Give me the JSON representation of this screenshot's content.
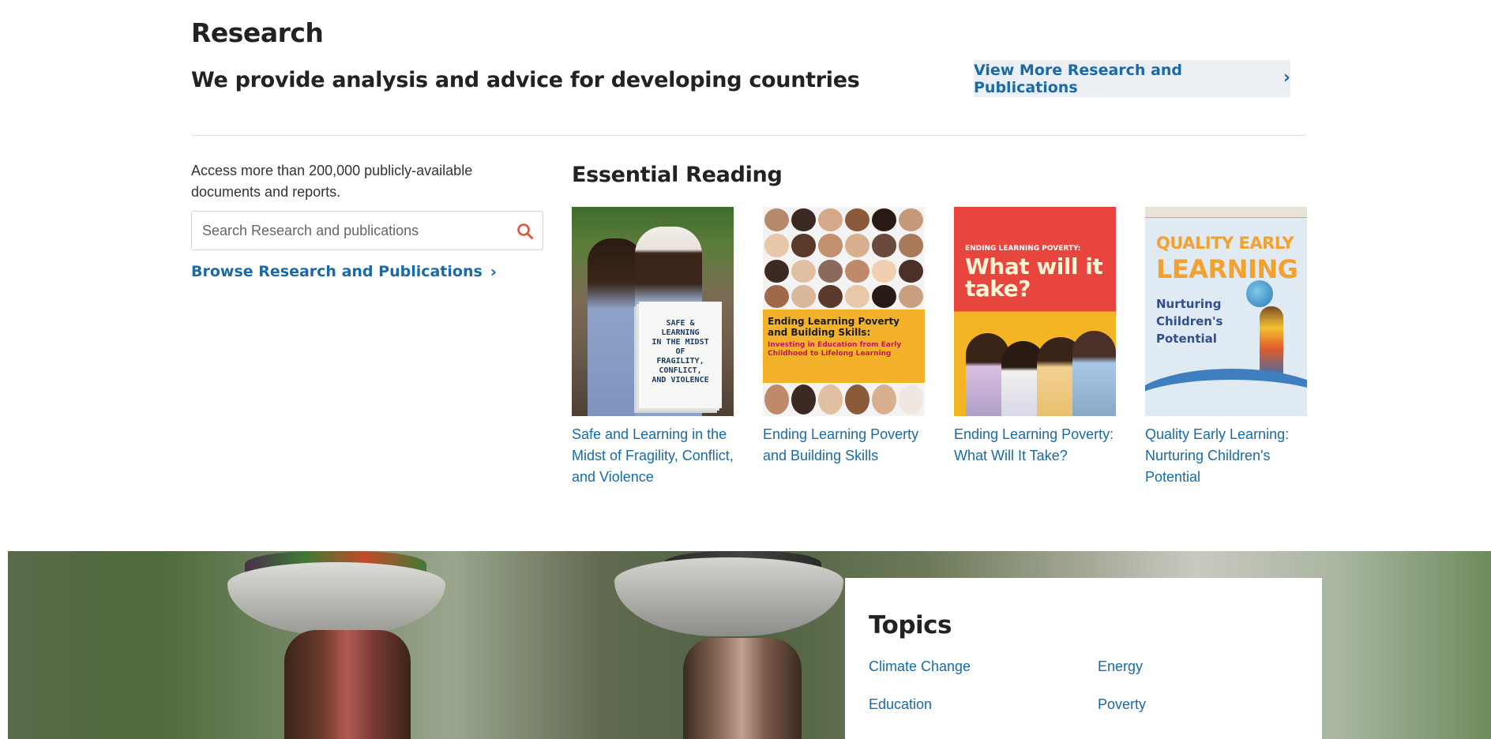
{
  "header": {
    "title": "Research",
    "subtitle": "We provide analysis and advice for developing countries",
    "view_more_label": "View More Research and Publications",
    "view_more_chevron": "›"
  },
  "search_panel": {
    "description": "Access more than 200,000 publicly-available documents and reports.",
    "search_placeholder": "Search Research and publications",
    "browse_label": "Browse Research and Publications",
    "browse_chevron": "›"
  },
  "essential_reading": {
    "title": "Essential Reading",
    "books": [
      {
        "title": "Safe and Learning in the Midst of Fragility, Conflict, and Violence",
        "cover_lines": [
          "SAFE & LEARNING",
          "IN THE MIDST OF",
          "FRAGILITY, CONFLICT,",
          "AND VIOLENCE"
        ]
      },
      {
        "title": "Ending Learning Poverty and Building Skills",
        "cover_heading": "Ending Learning Poverty and Building Skills:",
        "cover_sub": "Investing in Education from Early Childhood to Lifelong Learning"
      },
      {
        "title": "Ending Learning Poverty: What Will It Take?",
        "cover_heading": "ENDING LEARNING POVERTY:",
        "cover_sub": "What will it take?"
      },
      {
        "title": "Quality Early Learning: Nurturing Children's Potential",
        "cover_q1": "QUALITY EARLY",
        "cover_q2": "LEARNING",
        "cover_q3": "Nurturing Children's Potential"
      }
    ]
  },
  "topics": {
    "title": "Topics",
    "items": [
      "Climate Change",
      "Energy",
      "Education",
      "Poverty"
    ]
  },
  "colors": {
    "link": "#1a6aa8",
    "button_bg": "#ebeef2",
    "search_icon": "#e2553d"
  }
}
